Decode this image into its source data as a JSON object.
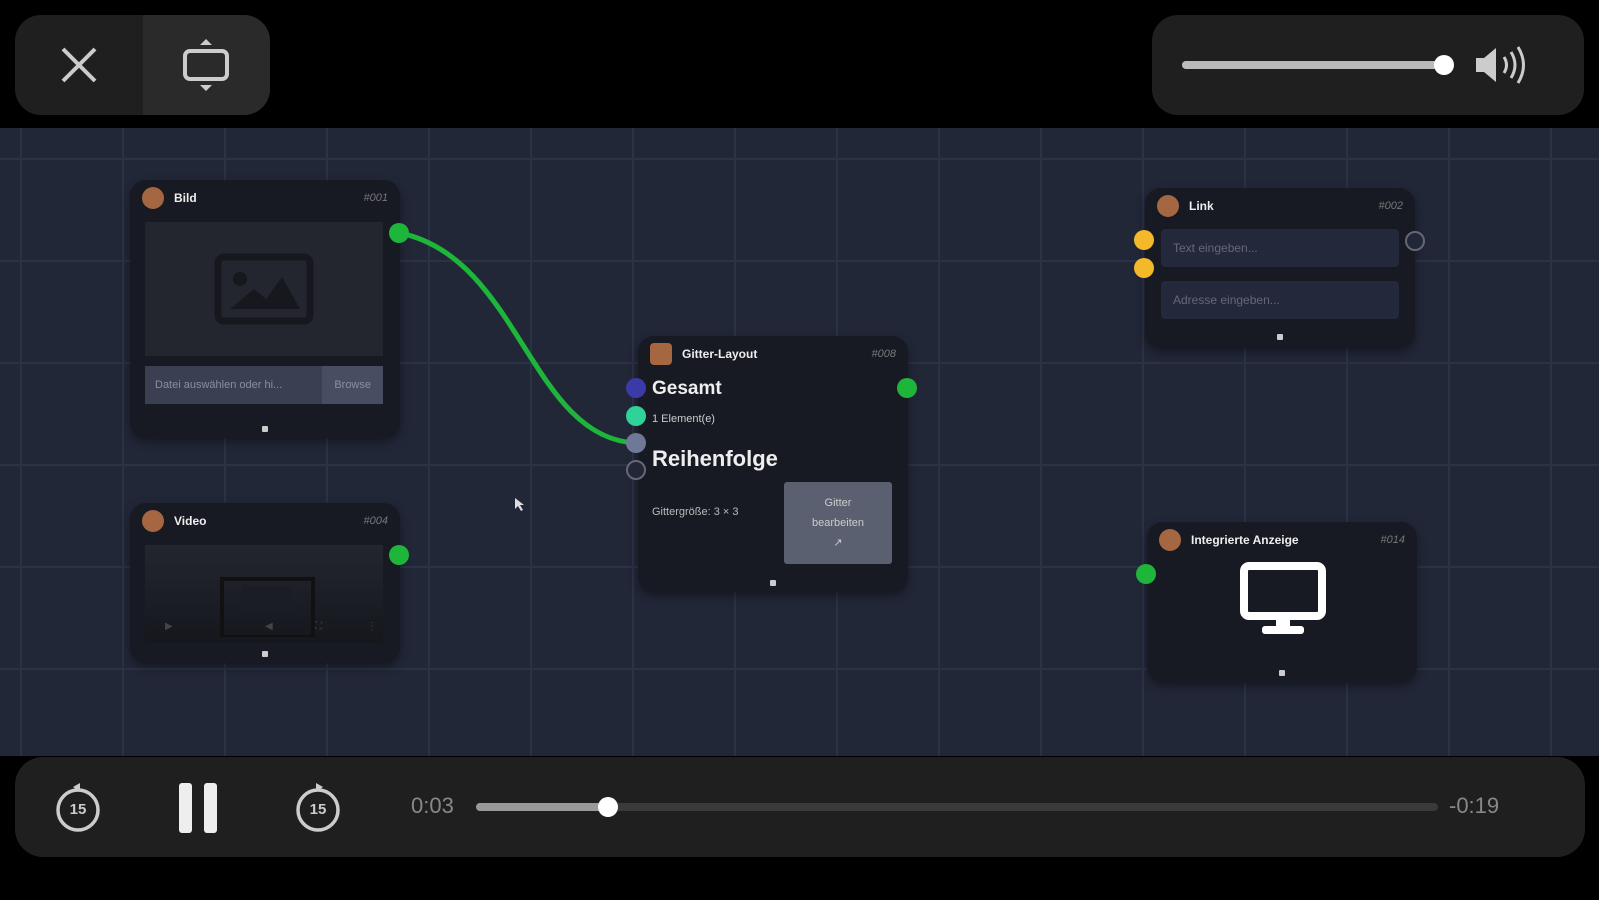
{
  "player": {
    "close_icon": "close-icon",
    "pip_icon": "picture-in-picture-icon",
    "volume_level": 1.0,
    "current_time": "0:03",
    "remaining_time": "-0:19",
    "progress": 0.137,
    "skip_back_label": "15",
    "skip_forward_label": "15"
  },
  "nodes": {
    "bild": {
      "title": "Bild",
      "id": "#001",
      "file_placeholder": "Datei auswählen oder hi...",
      "browse": "Browse"
    },
    "video": {
      "title": "Video",
      "id": "#004"
    },
    "grid": {
      "title": "Gitter-Layout",
      "id": "#008",
      "total": "Gesamt",
      "count": "1 Element(e)",
      "order": "Reihenfolge",
      "size": "Gittergröße: 3 × 3",
      "edit": "Gitter bearbeiten"
    },
    "link": {
      "title": "Link",
      "id": "#002",
      "text_placeholder": "Text eingeben...",
      "address_placeholder": "Adresse eingeben..."
    },
    "display": {
      "title": "Integrierte Anzeige",
      "id": "#014"
    }
  },
  "colors": {
    "connection": "#1db53a",
    "port_yellow": "#f3b92a",
    "port_blue": "#3a3aa8",
    "port_teal": "#2fd39a"
  }
}
